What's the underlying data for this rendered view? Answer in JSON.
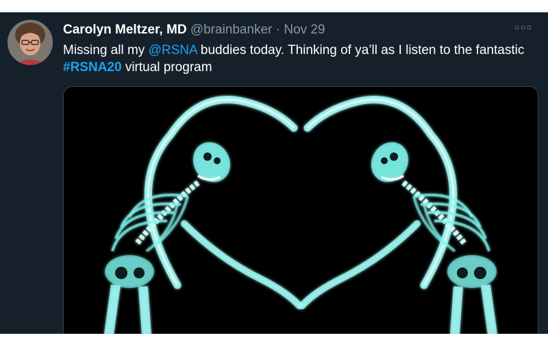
{
  "tweet": {
    "author_name": "Carolyn Meltzer, MD",
    "handle": "@brainbanker",
    "separator": "·",
    "date": "Nov 29",
    "more_icon": "more-options-icon",
    "text": {
      "part1": "Missing all my ",
      "mention": "@RSNA",
      "part2": " buddies today. Thinking of ya’ll as I listen to the fantastic ",
      "hashtag": "#RSNA20",
      "part3": " virtual program"
    },
    "media_subject": "x-ray skeletons forming a heart shape"
  },
  "colors": {
    "background": "#15202b",
    "text": "#ffffff",
    "muted": "#8899a6",
    "link": "#1da1f2",
    "xray": "#7ff3ec"
  }
}
